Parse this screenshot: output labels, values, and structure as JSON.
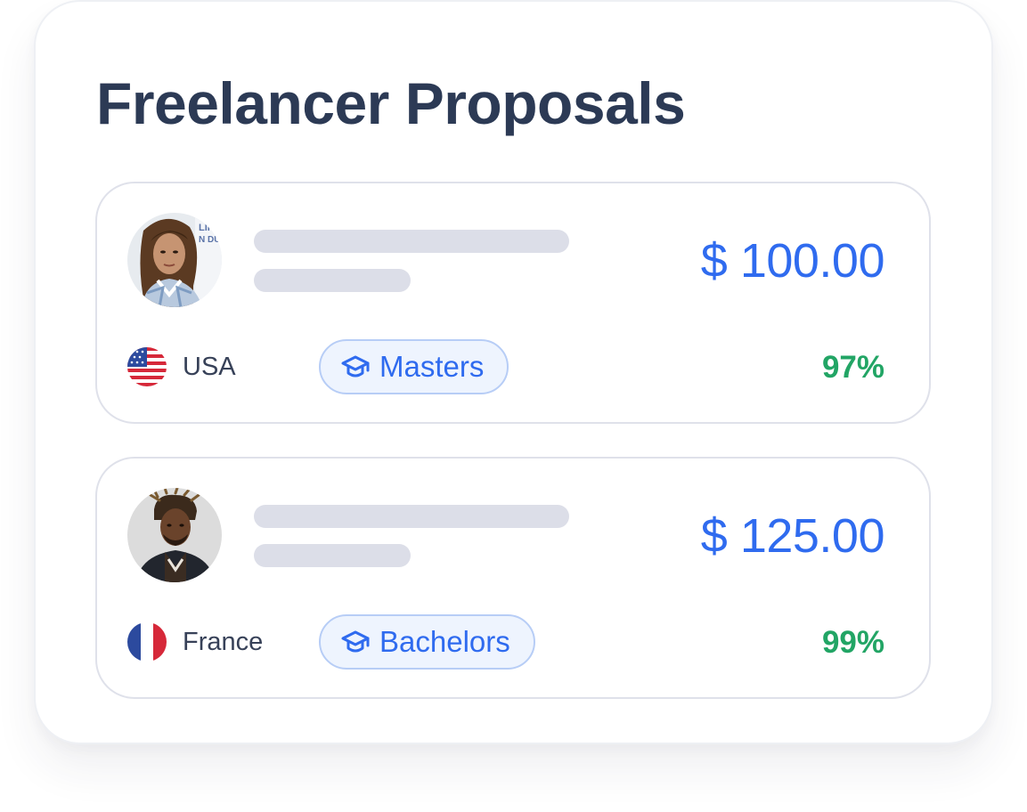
{
  "title": "Freelancer Proposals",
  "colors": {
    "heading": "#2c3a55",
    "price": "#2f6bef",
    "success": "#22a565",
    "skeleton": "#dcdee8",
    "badge_border": "#b7cdf6",
    "badge_bg": "#eef4fe"
  },
  "proposals": [
    {
      "avatar": "avatar-woman",
      "price": "$ 100.00",
      "country_flag": "usa-flag-icon",
      "country": "USA",
      "education_icon": "graduation-cap-icon",
      "education": "Masters",
      "score": "97%"
    },
    {
      "avatar": "avatar-man",
      "price": "$ 125.00",
      "country_flag": "france-flag-icon",
      "country": "France",
      "education_icon": "graduation-cap-icon",
      "education": "Bachelors",
      "score": "99%"
    }
  ]
}
